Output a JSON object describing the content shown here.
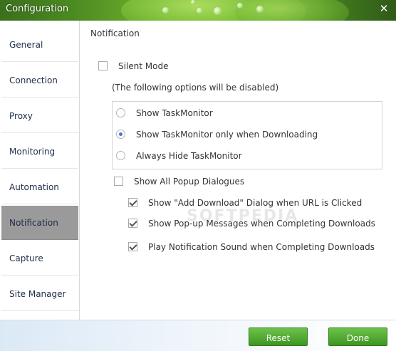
{
  "window": {
    "title": "Configuration",
    "close_icon": "close-icon"
  },
  "sidebar": {
    "items": [
      {
        "label": "General"
      },
      {
        "label": "Connection"
      },
      {
        "label": "Proxy"
      },
      {
        "label": "Monitoring"
      },
      {
        "label": "Automation"
      },
      {
        "label": "Notification"
      },
      {
        "label": "Capture"
      },
      {
        "label": "Site Manager"
      }
    ],
    "active": "Notification"
  },
  "main": {
    "section_title": "Notification",
    "silent_mode": {
      "label": "Silent Mode",
      "checked": false
    },
    "note": "(The following options will be disabled)",
    "taskmonitor_options": [
      {
        "label": "Show TaskMonitor",
        "selected": false
      },
      {
        "label": "Show TaskMonitor only when Downloading",
        "selected": true
      },
      {
        "label": "Always Hide TaskMonitor",
        "selected": false
      }
    ],
    "show_all_popups": {
      "label": "Show All Popup Dialogues",
      "checked": false
    },
    "popup_options": [
      {
        "label": "Show \"Add Download\" Dialog when URL is Clicked",
        "checked": true
      },
      {
        "label": "Show Pop-up Messages when Completing Downloads",
        "checked": true
      },
      {
        "label": "Play Notification Sound when Completing Downloads",
        "checked": true
      }
    ],
    "watermark": "SOFTPEDIA"
  },
  "footer": {
    "reset_label": "Reset",
    "done_label": "Done"
  },
  "colors": {
    "title_green": "#4b8a21",
    "active_nav": "#9a9a9a",
    "button_green": "#4ea82e",
    "radio_dot": "#4a74c9"
  }
}
